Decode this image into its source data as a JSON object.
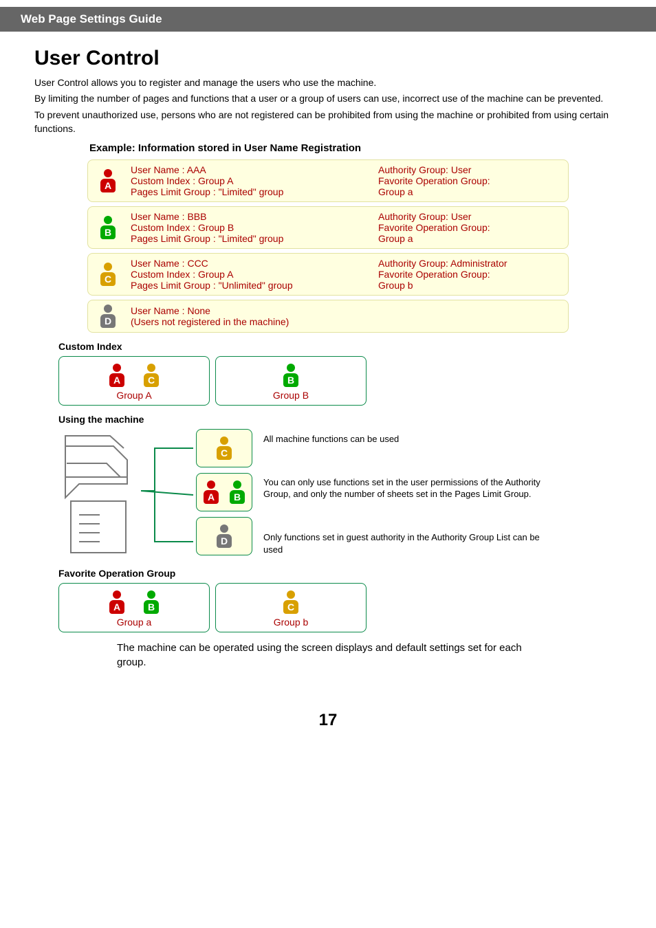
{
  "header": {
    "guide_title": "Web Page Settings Guide"
  },
  "page": {
    "title": "User Control",
    "intro_lines": [
      "User Control allows you to register and manage the users who use the machine.",
      "By limiting the number of pages and functions that a user or a group of users can use, incorrect use of the machine can be prevented.",
      "To prevent unauthorized use, persons who are not registered can be prohibited from using the machine or prohibited from using certain functions."
    ],
    "example_head": "Example: Information stored in User Name Registration"
  },
  "users": [
    {
      "badge": "A",
      "color": "red",
      "left": [
        "User Name : AAA",
        "Custom Index : Group A",
        "Pages Limit Group : \"Limited\" group"
      ],
      "right": [
        "Authority Group: User",
        "Favorite Operation Group:",
        "Group a"
      ]
    },
    {
      "badge": "B",
      "color": "green",
      "left": [
        "User Name : BBB",
        "Custom Index : Group B",
        "Pages Limit Group : \"Limited\" group"
      ],
      "right": [
        "Authority Group: User",
        "Favorite Operation Group:",
        "Group a"
      ]
    },
    {
      "badge": "C",
      "color": "yellow",
      "left": [
        "User Name : CCC",
        "Custom Index : Group A",
        "Pages Limit Group : \"Unlimited\" group"
      ],
      "right": [
        "Authority Group: Administrator",
        "Favorite Operation Group:",
        "Group b"
      ]
    },
    {
      "badge": "D",
      "color": "grey",
      "left": [
        "User Name : None",
        "(Users not registered in the machine)"
      ],
      "right": []
    }
  ],
  "custom_index": {
    "head": "Custom Index",
    "groups": [
      {
        "label": "Group A",
        "badges": [
          {
            "t": "A",
            "c": "red"
          },
          {
            "t": "C",
            "c": "yellow"
          }
        ]
      },
      {
        "label": "Group B",
        "badges": [
          {
            "t": "B",
            "c": "green"
          }
        ]
      }
    ]
  },
  "using": {
    "head": "Using the machine",
    "descs": [
      "All machine functions can be used",
      "You can only use functions set in the user permissions of the Authority Group, and only the number of sheets set in the Pages Limit Group.",
      "Only functions set in guest authority in the Authority Group List can be used"
    ]
  },
  "fav": {
    "head": "Favorite Operation Group",
    "groups": [
      {
        "label": "Group a",
        "badges": [
          {
            "t": "A",
            "c": "red"
          },
          {
            "t": "B",
            "c": "green"
          }
        ]
      },
      {
        "label": "Group b",
        "badges": [
          {
            "t": "C",
            "c": "yellow"
          }
        ]
      }
    ],
    "note": "The machine can be operated using the screen displays and default settings set for each group."
  },
  "page_num": "17",
  "icons": {
    "badge_letters": {
      "A": "A",
      "B": "B",
      "C": "C",
      "D": "D"
    }
  }
}
